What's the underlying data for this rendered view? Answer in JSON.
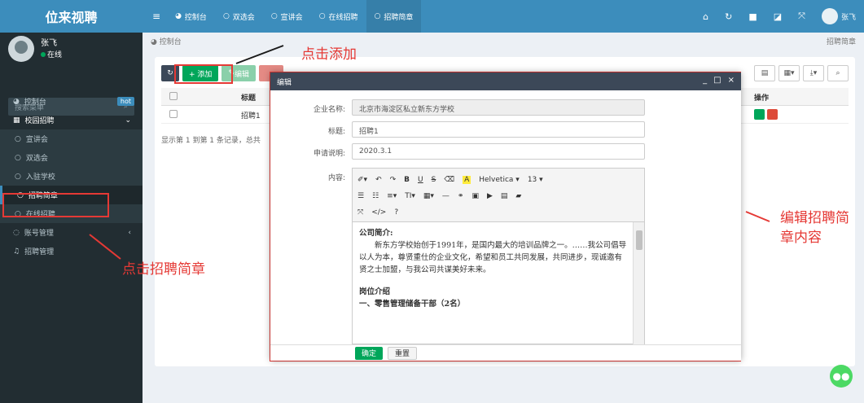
{
  "app": {
    "title": "位来视聘"
  },
  "user": {
    "name": "张飞",
    "status": "在线"
  },
  "sidebar": {
    "search_placeholder": "搜索菜单",
    "items": [
      {
        "label": "控制台",
        "badge": "hot"
      },
      {
        "label": "校园招聘"
      },
      {
        "label": "宣讲会"
      },
      {
        "label": "双选会"
      },
      {
        "label": "入驻学校"
      },
      {
        "label": "招聘简章"
      },
      {
        "label": "在线招聘"
      },
      {
        "label": "账号管理"
      },
      {
        "label": "招聘管理"
      }
    ]
  },
  "topnav": {
    "tabs": [
      {
        "label": "控制台"
      },
      {
        "label": "双选会"
      },
      {
        "label": "宣讲会"
      },
      {
        "label": "在线招聘"
      },
      {
        "label": "招聘简章"
      }
    ],
    "user_short": "张飞"
  },
  "breadcrumb": {
    "left": "控制台",
    "right": "招聘简章"
  },
  "toolbar": {
    "add_label": "+ 添加",
    "edit_label": "编辑"
  },
  "table": {
    "headers": [
      "标题",
      "操作"
    ],
    "rows": [
      {
        "title": "招聘1"
      }
    ],
    "pagination": "显示第 1 到第 1 条记录，总共"
  },
  "annotations": {
    "add": "点击添加",
    "brochure": "点击招聘简章",
    "edit": "编辑招聘简章内容"
  },
  "modal": {
    "title": "编辑",
    "fields": {
      "company_label": "企业名称:",
      "company_value": "北京市海淀区私立新东方学校",
      "title_label": "标题:",
      "title_value": "招聘1",
      "desc_label": "申请说明:",
      "desc_value": "2020.3.1",
      "content_label": "内容:"
    },
    "editor": {
      "font_name": "Helvetica",
      "font_size": "13",
      "heading1": "公司简介:",
      "para1": "新东方学校始创于1991年，是国内最大的培训品牌之一。……我公司倡导以人为本，尊贤重仕的企业文化，希望和员工共同发展，共同进步，现诚邀有贤之士加盟，与我公司共谋美好未来。",
      "heading2": "岗位介绍",
      "heading3": "一、零售管理储备干部（2名）"
    },
    "ok_label": "确定",
    "cancel_label": "重置"
  },
  "colors": {
    "brand": "#3c8dbc",
    "sidebar": "#222d32",
    "annotation": "#e53935",
    "success": "#00a65a"
  }
}
